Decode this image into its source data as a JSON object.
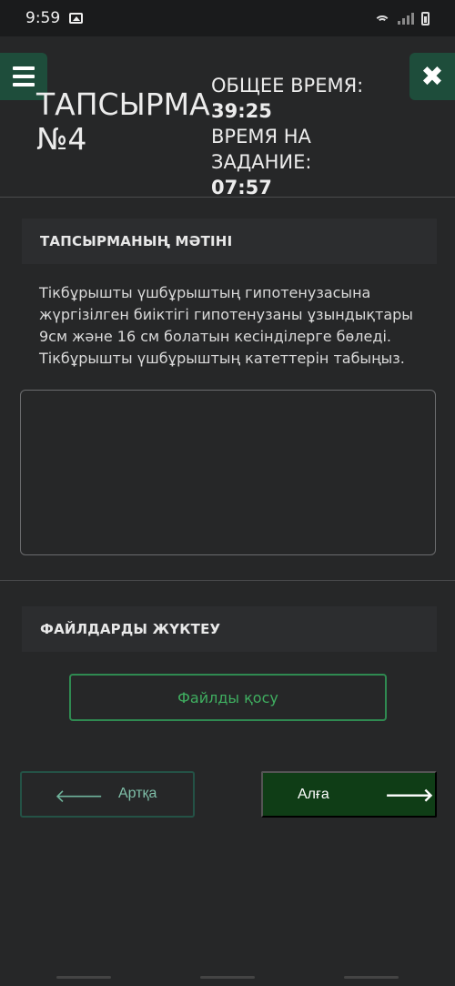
{
  "status_bar": {
    "time": "9:59"
  },
  "header": {
    "task_title": "ТАПСЫРМА №4",
    "total_time_label": "ОБЩЕЕ ВРЕМЯ:",
    "total_time_value": "39:25",
    "task_time_label": "ВРЕМЯ НА ЗАДАНИЕ:",
    "task_time_value": "07:57"
  },
  "task": {
    "section_title": "ТАПСЫРМАНЫҢ МӘТІНІ",
    "text": "Тікбұрышты үшбұрыштың гипотенузасына жүргізілген биіктігі гипотенузаны ұзындықтары 9см және 16 см болатын кесінділерге бөледі. Тікбұрышты үшбұрыштың катеттерін табыңыз.",
    "answer_value": ""
  },
  "files": {
    "section_title": "ФАЙЛДАРДЫ ЖҮКТЕУ",
    "add_button": "Файлды қосу"
  },
  "navigation": {
    "back_label": "Артқа",
    "next_label": "Алға"
  },
  "icons": {
    "menu": "menu-icon",
    "close": "close-icon",
    "back": "arrow-left-icon",
    "next": "arrow-right-icon"
  },
  "colors": {
    "accent_dark_green": "#1e4d3b",
    "button_green": "#0f3d16",
    "outline_green": "#2f8a51",
    "background": "#262728"
  }
}
